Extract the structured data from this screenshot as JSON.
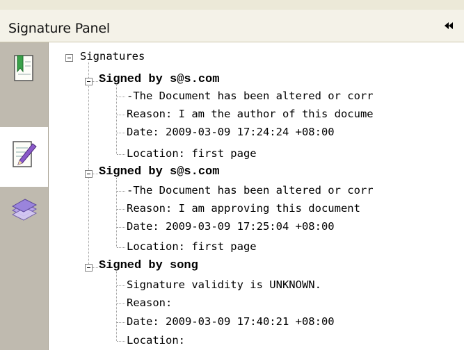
{
  "panel": {
    "title": "Signature Panel",
    "collapse_glyph": "◂◂"
  },
  "rail": {
    "tabs": [
      {
        "name": "bookmarks",
        "icon": "bookmark-page-icon",
        "active": false
      },
      {
        "name": "signatures",
        "icon": "signature-pen-icon",
        "active": true
      },
      {
        "name": "layers",
        "icon": "layers-icon",
        "active": false
      }
    ]
  },
  "tree": {
    "root_label": "Signatures",
    "signatures": [
      {
        "label": "Signed by s@s.com",
        "details": [
          "-The Document has been altered or corr",
          "Reason: I am the author of this docume",
          "Date: 2009-03-09 17:24:24 +08:00",
          "Location: first page"
        ]
      },
      {
        "label": "Signed by s@s.com",
        "details": [
          "-The Document has been altered or corr",
          "Reason: I am approving this document",
          "Date: 2009-03-09 17:25:04 +08:00",
          "Location: first page"
        ]
      },
      {
        "label": "Signed by song",
        "details": [
          "Signature validity is UNKNOWN.",
          "Reason:",
          "Date: 2009-03-09 17:40:21 +08:00",
          "Location:"
        ]
      }
    ]
  },
  "colors": {
    "rail_bg": "#bfbaaf",
    "header_bg": "#f4f2e8",
    "content_bg": "#ffffff"
  }
}
